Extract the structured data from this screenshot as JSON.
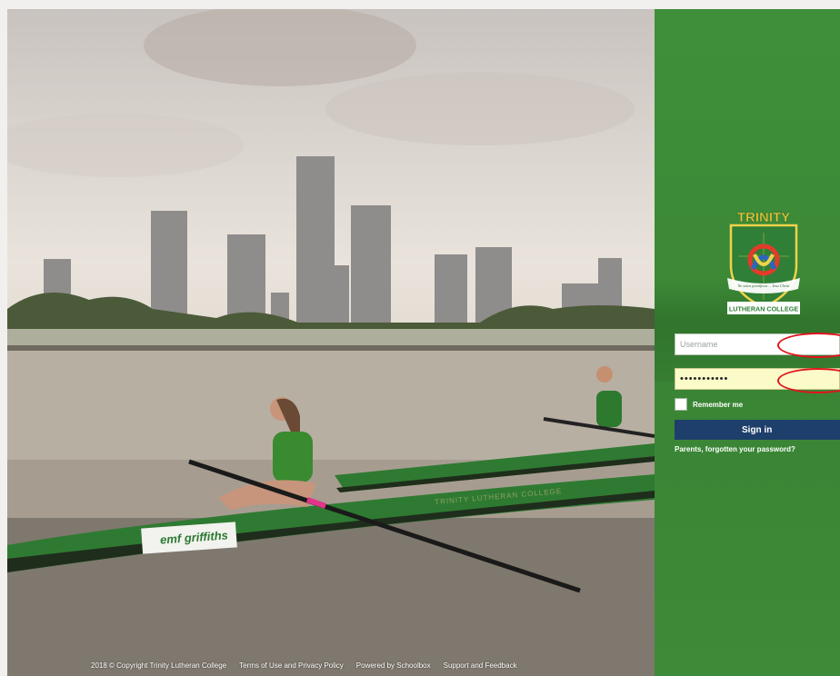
{
  "photo": {
    "boat_sponsor": "emf griffiths",
    "boat_name": "TRINITY LUTHERAN COLLEGE"
  },
  "footer": {
    "copyright": "2018 © Copyright Trinity Lutheran College",
    "terms": "Terms of Use and Privacy Policy",
    "powered_by": "Powered by Schoolbox",
    "support": "Support and Feedback"
  },
  "login": {
    "crest": {
      "icon": "trinity-lutheran-college-crest",
      "top_text": "TRINITY",
      "motto": "Ne solus pontificus ... Iesu Christ",
      "bottom_text": "LUTHERAN COLLEGE"
    },
    "username_placeholder": "Username",
    "username_value": "",
    "password_value": "•••••••••••",
    "remember_label": "Remember me",
    "signin_label": "Sign in",
    "forgot_link": "Parents, forgotten your password?"
  },
  "colors": {
    "panel_green": "#3d8a38",
    "signin_button": "#1e3f6b",
    "password_autofill": "#fbfbc9",
    "annotation_red": "#e0141c"
  }
}
